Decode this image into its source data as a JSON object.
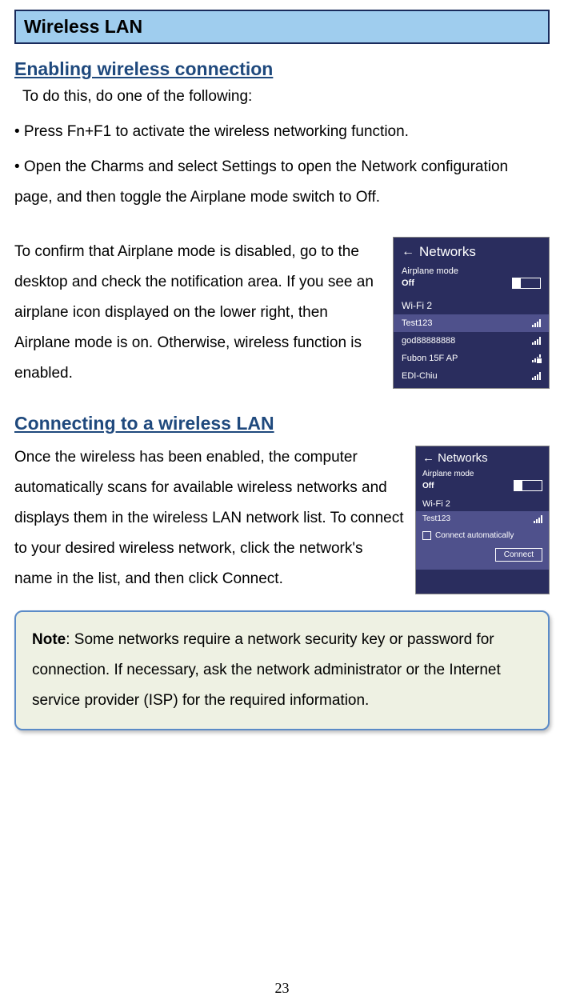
{
  "banner": {
    "title": "Wireless LAN"
  },
  "sec1": {
    "heading": "Enabling wireless connection",
    "intro": "To do this, do one of the following:",
    "bullet1": "• Press Fn+F1 to activate the wireless networking function.",
    "bullet2": "• Open the Charms and select Settings to open the Network configuration page, and then toggle the Airplane mode switch to Off.",
    "confirm": "To confirm that Airplane mode is disabled, go to the desktop and check the notification area. If you see an airplane icon displayed on the lower right, then Airplane mode is on. Otherwise, wireless function is enabled."
  },
  "panel1": {
    "title": "Networks",
    "airplane_label": "Airplane mode",
    "airplane_state": "Off",
    "wifi_label": "Wi-Fi 2",
    "items": [
      {
        "name": "Test123",
        "selected": true,
        "locked": false
      },
      {
        "name": "god88888888",
        "selected": false,
        "locked": false
      },
      {
        "name": "Fubon 15F AP",
        "selected": false,
        "locked": true
      },
      {
        "name": "EDI-Chiu",
        "selected": false,
        "locked": false
      }
    ]
  },
  "sec2": {
    "heading": "Connecting to a wireless LAN",
    "body": "Once the wireless has been enabled, the computer automatically scans for available wireless networks and displays them in the wireless LAN network list. To connect to your desired wireless network, click the network's name in the list, and then click Connect."
  },
  "panel2": {
    "title": "Networks",
    "airplane_label": "Airplane mode",
    "airplane_state": "Off",
    "wifi_label": "Wi-Fi 2",
    "selected_net": "Test123",
    "auto_label": "Connect automatically",
    "connect_label": "Connect"
  },
  "note": {
    "label": "Note",
    "body": ": Some networks require a network security key or password for connection. If necessary, ask the network administrator or the Internet service provider (ISP) for the required information."
  },
  "page_number": "23"
}
